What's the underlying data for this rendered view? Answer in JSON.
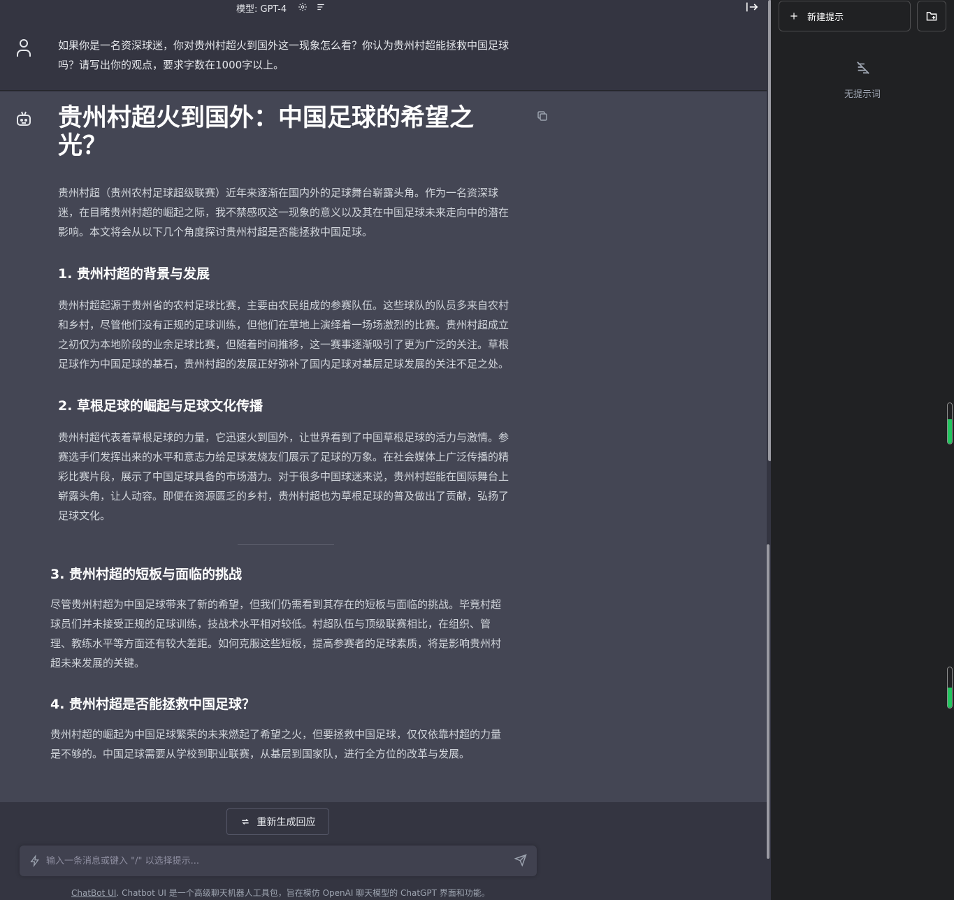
{
  "header": {
    "model_label": "模型: GPT-4"
  },
  "user_message": {
    "text": "如果你是一名资深球迷，你对贵州村超火到国外这一现象怎么看？你认为贵州村超能拯救中国足球吗？请写出你的观点，要求字数在1000字以上。"
  },
  "assistant_message": {
    "title": "贵州村超火到国外：中国足球的希望之光？",
    "intro": "贵州村超（贵州农村足球超级联赛）近年来逐渐在国内外的足球舞台崭露头角。作为一名资深球迷，在目睹贵州村超的崛起之际，我不禁感叹这一现象的意义以及其在中国足球未来走向中的潜在影响。本文将会从以下几个角度探讨贵州村超是否能拯救中国足球。",
    "sections": [
      {
        "heading": "1. 贵州村超的背景与发展",
        "body": "贵州村超起源于贵州省的农村足球比赛，主要由农民组成的参赛队伍。这些球队的队员多来自农村和乡村，尽管他们没有正规的足球训练，但他们在草地上演绎着一场场激烈的比赛。贵州村超成立之初仅为本地阶段的业余足球比赛，但随着时间推移，这一赛事逐渐吸引了更为广泛的关注。草根足球作为中国足球的基石，贵州村超的发展正好弥补了国内足球对基层足球发展的关注不足之处。"
      },
      {
        "heading": "2. 草根足球的崛起与足球文化传播",
        "body": "贵州村超代表着草根足球的力量，它迅速火到国外，让世界看到了中国草根足球的活力与激情。参赛选手们发挥出来的水平和意志力给足球发烧友们展示了足球的万象。在社会媒体上广泛传播的精彩比赛片段，展示了中国足球具备的市场潜力。对于很多中国球迷来说，贵州村超能在国际舞台上崭露头角，让人动容。即便在资源匮乏的乡村，贵州村超也为草根足球的普及做出了贡献，弘扬了足球文化。"
      },
      {
        "heading": "3. 贵州村超的短板与面临的挑战",
        "body": "尽管贵州村超为中国足球带来了新的希望，但我们仍需看到其存在的短板与面临的挑战。毕竟村超球员们并未接受正规的足球训练，技战术水平相对较低。村超队伍与顶级联赛相比，在组织、管理、教练水平等方面还有较大差距。如何克服这些短板，提高参赛者的足球素质，将是影响贵州村超未来发展的关键。"
      },
      {
        "heading": "4. 贵州村超是否能拯救中国足球？",
        "body": "贵州村超的崛起为中国足球繁荣的未来燃起了希望之火，但要拯救中国足球，仅仅依靠村超的力量是不够的。中国足球需要从学校到职业联赛，从基层到国家队，进行全方位的改革与发展。"
      }
    ]
  },
  "bottom": {
    "regenerate_label": "重新生成回应",
    "input_placeholder": "输入一条消息或键入 \"/\" 以选择提示...",
    "footer_link": "ChatBot UI",
    "footer_text": ". Chatbot UI 是一个高级聊天机器人工具包，旨在模仿 OpenAI 聊天模型的 ChatGPT 界面和功能。"
  },
  "sidebar": {
    "new_prompt_label": "新建提示",
    "empty_label": "无提示词"
  },
  "meters": [
    0.6,
    0.5
  ],
  "colors": {
    "background": "#343541",
    "assistant_background": "#444654",
    "sidebar_background": "#202123",
    "meter_fill": "#22c55e"
  },
  "icons": [
    "settings-icon",
    "clear-conversation-icon",
    "sidebar-toggle-icon",
    "user-icon",
    "robot-icon",
    "copy-icon",
    "refresh-icon",
    "bolt-icon",
    "send-icon",
    "plus-icon",
    "new-folder-icon",
    "no-prompts-icon"
  ]
}
